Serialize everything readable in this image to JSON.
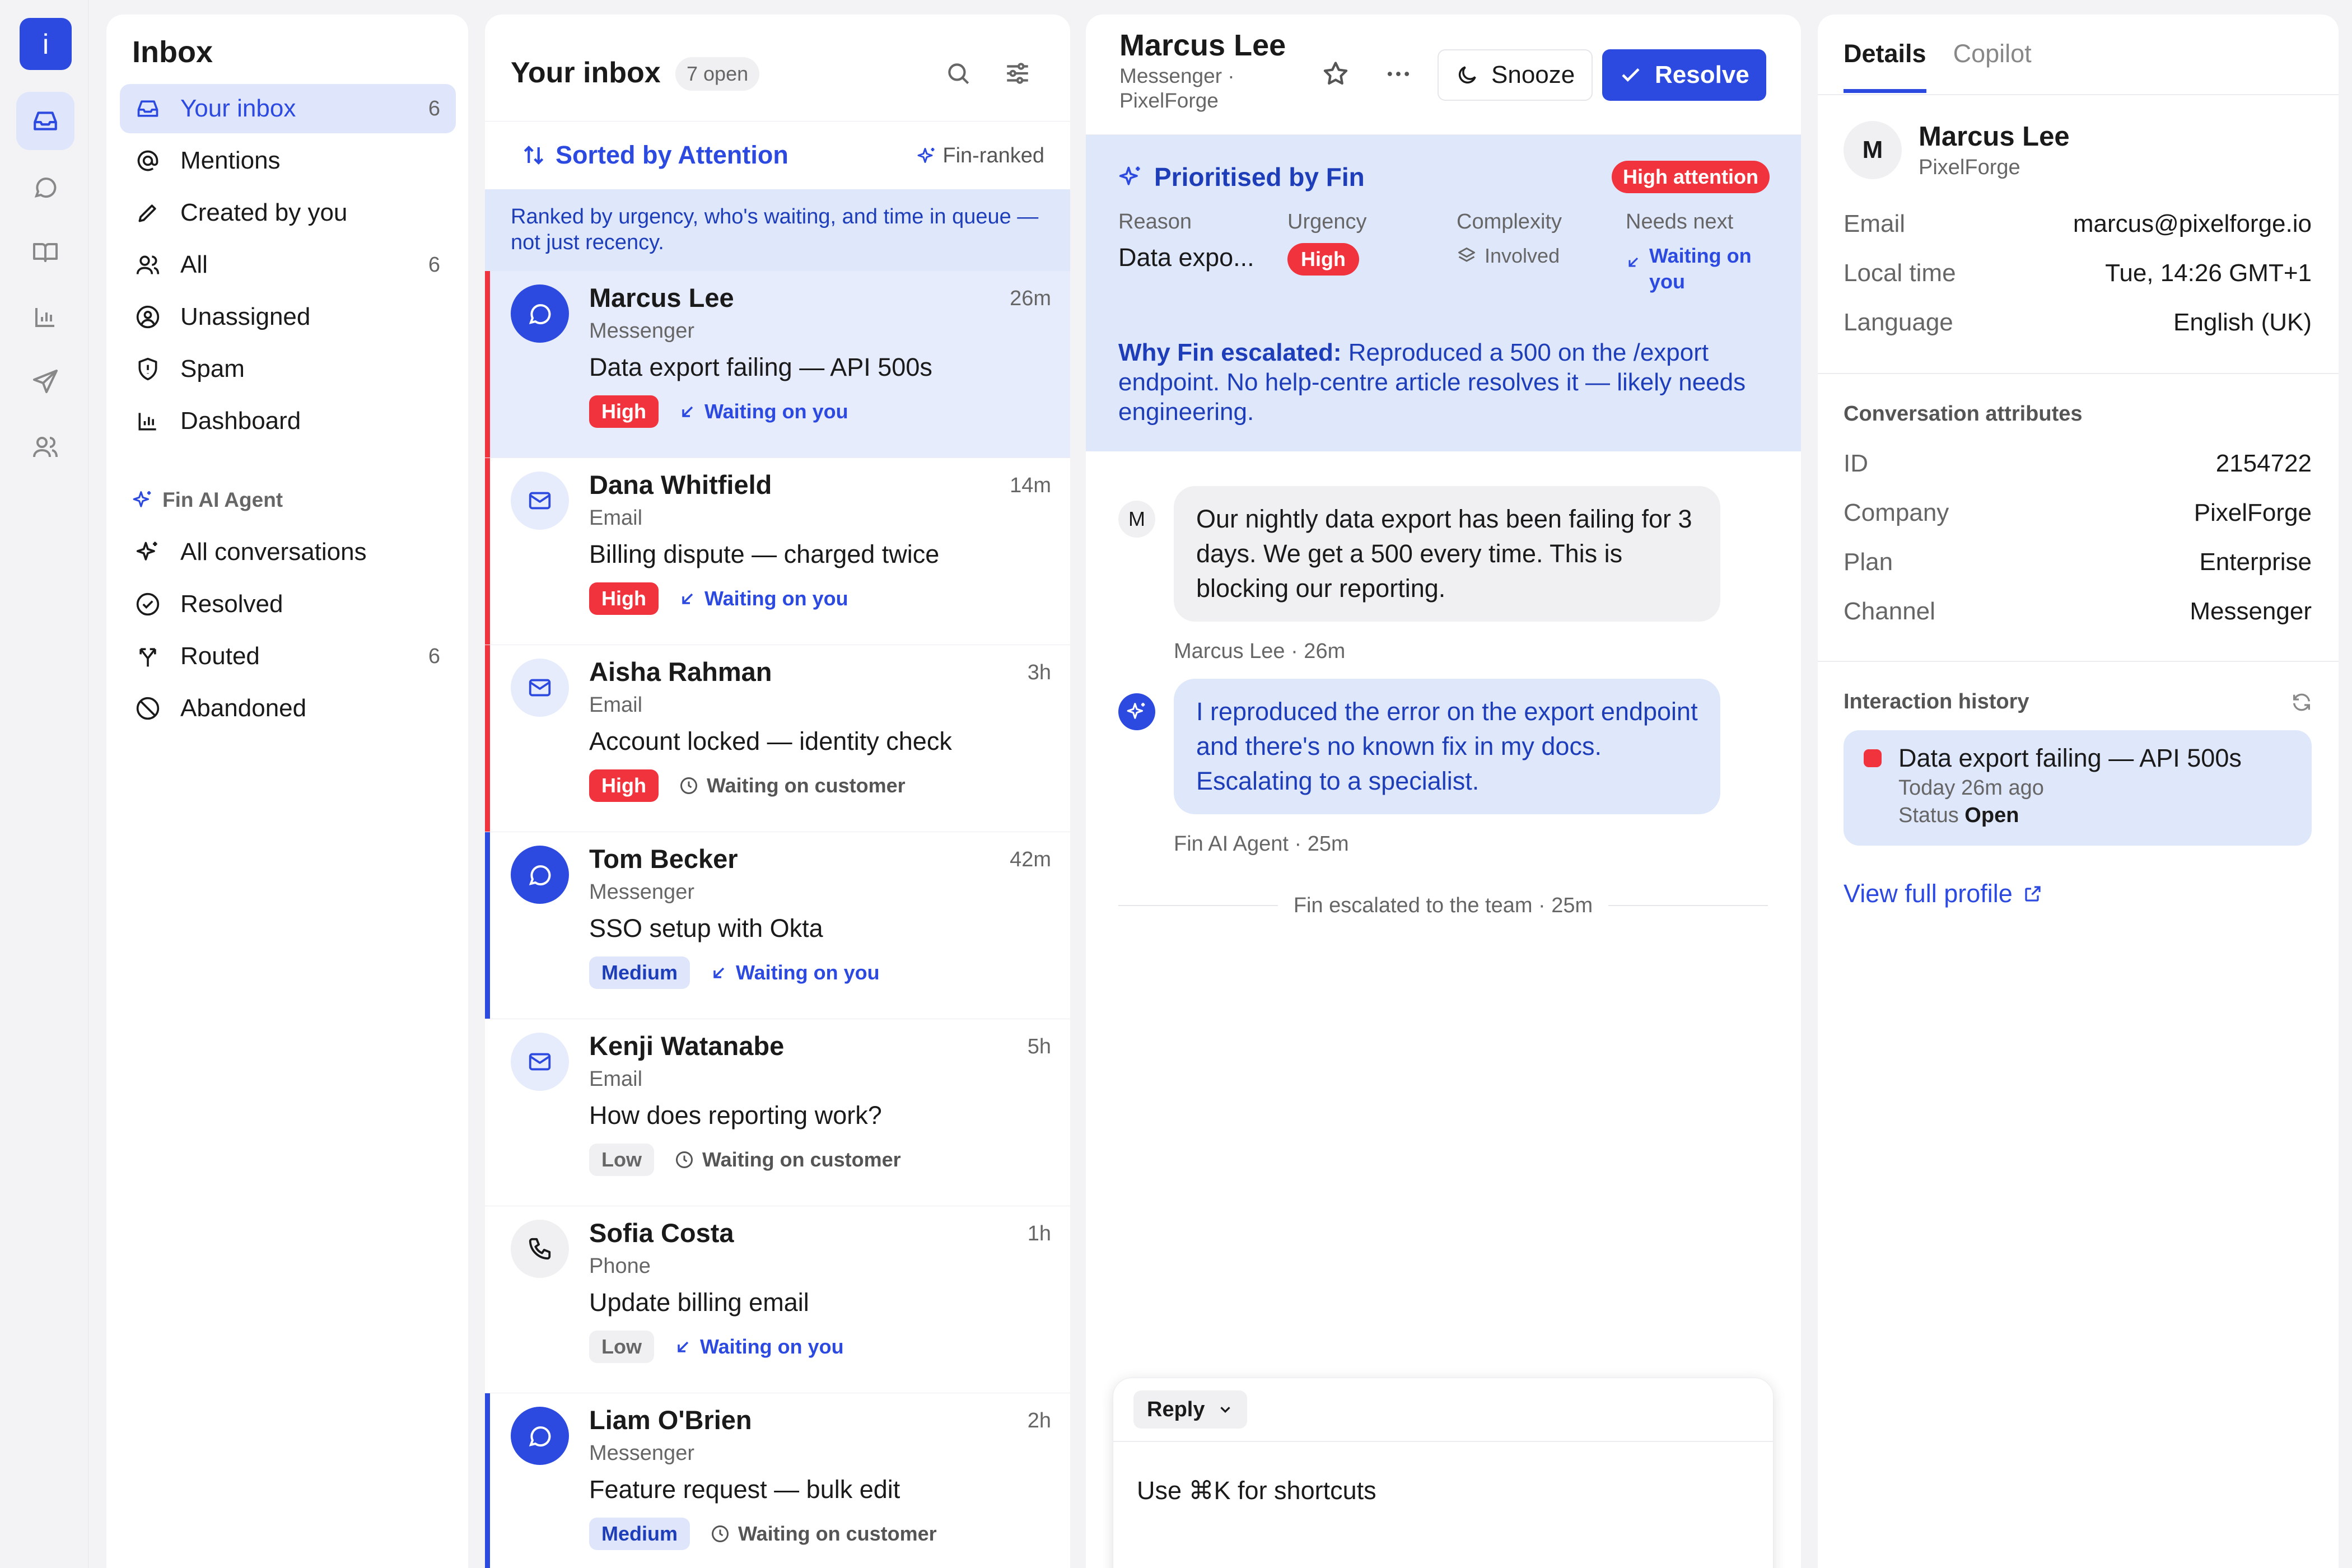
{
  "rail": {
    "brand": "i"
  },
  "nav": {
    "title": "Inbox",
    "items": [
      {
        "label": "Your inbox",
        "count": "6"
      },
      {
        "label": "Mentions",
        "count": ""
      },
      {
        "label": "Created by you",
        "count": ""
      },
      {
        "label": "All",
        "count": "6"
      },
      {
        "label": "Unassigned",
        "count": ""
      },
      {
        "label": "Spam",
        "count": ""
      },
      {
        "label": "Dashboard",
        "count": ""
      }
    ],
    "section": "Fin AI Agent",
    "fin_items": [
      {
        "label": "All conversations",
        "count": ""
      },
      {
        "label": "Resolved",
        "count": ""
      },
      {
        "label": "Routed",
        "count": "6"
      },
      {
        "label": "Abandoned",
        "count": ""
      }
    ]
  },
  "list": {
    "title": "Your inbox",
    "open_badge": "7 open",
    "sort_label": "Sorted by Attention",
    "fin_ranked": "Fin-ranked",
    "ranked_note": "Ranked by urgency, who's waiting, and time in queue — not just recency.",
    "rows": [
      {
        "name": "Marcus Lee",
        "time": "26m",
        "channel": "Messenger",
        "subject": "Data export failing — API 500s",
        "priority": "High",
        "waiting": "Waiting on you"
      },
      {
        "name": "Dana Whitfield",
        "time": "14m",
        "channel": "Email",
        "subject": "Billing dispute — charged twice",
        "priority": "High",
        "waiting": "Waiting on you"
      },
      {
        "name": "Aisha Rahman",
        "time": "3h",
        "channel": "Email",
        "subject": "Account locked — identity check",
        "priority": "High",
        "waiting": "Waiting on customer"
      },
      {
        "name": "Tom Becker",
        "time": "42m",
        "channel": "Messenger",
        "subject": "SSO setup with Okta",
        "priority": "Medium",
        "waiting": "Waiting on you"
      },
      {
        "name": "Kenji Watanabe",
        "time": "5h",
        "channel": "Email",
        "subject": "How does reporting work?",
        "priority": "Low",
        "waiting": "Waiting on customer"
      },
      {
        "name": "Sofia Costa",
        "time": "1h",
        "channel": "Phone",
        "subject": "Update billing email",
        "priority": "Low",
        "waiting": "Waiting on you"
      },
      {
        "name": "Liam O'Brien",
        "time": "2h",
        "channel": "Messenger",
        "subject": "Feature request — bulk edit",
        "priority": "Medium",
        "waiting": "Waiting on customer"
      }
    ]
  },
  "conversation": {
    "name": "Marcus Lee",
    "sub": "Messenger · PixelForge",
    "snooze": "Snooze",
    "resolve": "Resolve",
    "fin": {
      "title": "Prioritised by Fin",
      "badge": "High attention",
      "reason_h": "Reason",
      "reason_v": "Data expo...",
      "urgency_h": "Urgency",
      "urgency_v": "High",
      "complexity_h": "Complexity",
      "complexity_v": "Involved",
      "next_h": "Needs next",
      "next_v": "Waiting on you",
      "why_label": "Why Fin escalated:",
      "why_text": " Reproduced a 500 on the /export endpoint. No help-centre article resolves it — likely needs engineering."
    },
    "messages": [
      {
        "avatar": "M",
        "text": "Our nightly data export has been failing for 3 days. We get a 500 every time. This is blocking our reporting.",
        "meta": "Marcus Lee · 26m"
      },
      {
        "avatar": "",
        "text": "I reproduced the error on the export endpoint and there's no known fix in my docs. Escalating to a specialist.",
        "meta": "Fin AI Agent · 25m"
      }
    ],
    "event": "Fin escalated to the team · 25m",
    "reply_label": "Reply",
    "composer_placeholder": "Use ⌘K for shortcuts"
  },
  "details": {
    "tabs": [
      "Details",
      "Copilot"
    ],
    "avatar": "M",
    "name": "Marcus Lee",
    "company": "PixelForge",
    "fields": [
      {
        "k": "Email",
        "v": "marcus@pixelforge.io"
      },
      {
        "k": "Local time",
        "v": "Tue, 14:26 GMT+1"
      },
      {
        "k": "Language",
        "v": "English (UK)"
      }
    ],
    "attributes_title": "Conversation attributes",
    "attributes": [
      {
        "k": "ID",
        "v": "2154722"
      },
      {
        "k": "Company",
        "v": "PixelForge"
      },
      {
        "k": "Plan",
        "v": "Enterprise"
      },
      {
        "k": "Channel",
        "v": "Messenger"
      }
    ],
    "history_title": "Interaction history",
    "history": {
      "title": "Data export failing — API 500s",
      "when": "Today 26m ago",
      "status_label": "Status",
      "status": "Open"
    },
    "view_profile": "View full profile"
  },
  "colors": {
    "accent": "#2d4ae0",
    "high": "#f0333c",
    "accent_light": "#dfe7fb"
  },
  "icons": [
    "inbox-icon",
    "chat-icon",
    "book-icon",
    "chart-icon",
    "send-icon",
    "users-icon",
    "search-icon",
    "sliders-icon",
    "star-icon",
    "more-icon",
    "moon-icon",
    "check-icon",
    "sparkle-icon",
    "mail-icon",
    "phone-icon",
    "clock-icon",
    "arrow-in-icon",
    "refresh-icon",
    "external-link-icon"
  ]
}
